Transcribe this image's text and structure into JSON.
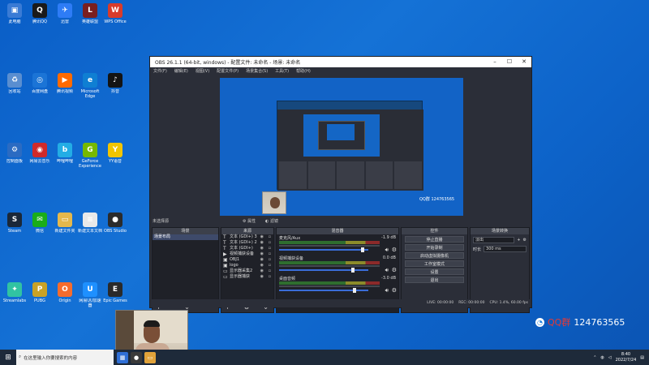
{
  "desktop": {
    "icons": [
      {
        "label": "此电脑",
        "color": "#3a7bd5",
        "glyph": "▣"
      },
      {
        "label": "腾讯QQ",
        "color": "#1a1a1a",
        "glyph": "Q"
      },
      {
        "label": "迅雷",
        "color": "#2e7cf6",
        "glyph": "✈"
      },
      {
        "label": "英雄联盟",
        "color": "#7a1f1f",
        "glyph": "L"
      },
      {
        "label": "WPS Office",
        "color": "#d83b2b",
        "glyph": "W"
      },
      {
        "label": "回收站",
        "color": "#5a8ed0",
        "glyph": "♻"
      },
      {
        "label": "百度网盘",
        "color": "#1b74d6",
        "glyph": "◎"
      },
      {
        "label": "腾讯视频",
        "color": "#ff6a00",
        "glyph": "▶"
      },
      {
        "label": "Microsoft Edge",
        "color": "#0f7fd3",
        "glyph": "e"
      },
      {
        "label": "抖音",
        "color": "#141414",
        "glyph": "♪"
      },
      {
        "label": "控制面板",
        "color": "#2b6bc2",
        "glyph": "⚙"
      },
      {
        "label": "网易云音乐",
        "color": "#d02a2a",
        "glyph": "◉"
      },
      {
        "label": "哔哩哔哩",
        "color": "#23ade5",
        "glyph": "b"
      },
      {
        "label": "GeForce Experience",
        "color": "#76b900",
        "glyph": "G"
      },
      {
        "label": "YY语音",
        "color": "#f2c500",
        "glyph": "Y"
      },
      {
        "label": "Steam",
        "color": "#1b2838",
        "glyph": "S"
      },
      {
        "label": "微信",
        "color": "#1aad19",
        "glyph": "✉"
      },
      {
        "label": "新建文件夹",
        "color": "#e6b84c",
        "glyph": "▭"
      },
      {
        "label": "新建文本文档",
        "color": "#e9e9e9",
        "glyph": "≡"
      },
      {
        "label": "OBS Studio",
        "color": "#2b2b2b",
        "glyph": "●"
      },
      {
        "label": "Streamlabs",
        "color": "#31c3a2",
        "glyph": "✦"
      },
      {
        "label": "PUBG",
        "color": "#c9a226",
        "glyph": "P"
      },
      {
        "label": "Origin",
        "color": "#f56c2d",
        "glyph": "O"
      },
      {
        "label": "网易UU加速器",
        "color": "#1e90ff",
        "glyph": "U"
      },
      {
        "label": "Epic Games",
        "color": "#2a2a2a",
        "glyph": "E"
      }
    ]
  },
  "obs": {
    "title": "OBS 26.1.1 (64-bit, windows) - 配置文件: 未命名 - 场景: 未命名",
    "menu": [
      "文件(F)",
      "编辑(E)",
      "视图(V)",
      "配置文件(P)",
      "场景集合(S)",
      "工具(T)",
      "帮助(H)"
    ],
    "no_source_selected": "未选择源",
    "properties_label": "属性",
    "filters_label": "滤镜",
    "preview_qq": "QQ群 124763565",
    "docks": {
      "scenes": {
        "title": "场景",
        "items": [
          "场景布局"
        ]
      },
      "sources": {
        "title": "来源",
        "items": [
          {
            "icon": "T",
            "label": "文本 (GDI+) 3"
          },
          {
            "icon": "T",
            "label": "文本 (GDI+) 2"
          },
          {
            "icon": "T",
            "label": "文本 (GDI+)"
          },
          {
            "icon": "▶",
            "label": "视频捕获设备"
          },
          {
            "icon": "▣",
            "label": "OBJ1"
          },
          {
            "icon": "▣",
            "label": "logo"
          },
          {
            "icon": "▭",
            "label": "显示器采集2"
          },
          {
            "icon": "▭",
            "label": "显示器捕获"
          }
        ]
      },
      "mixer": {
        "title": "混音器",
        "channels": [
          {
            "name": "麦克风/Aux",
            "db": "-1.9 dB"
          },
          {
            "name": "视频捕获设备",
            "db": "0.0 dB"
          },
          {
            "name": "桌面音频",
            "db": "-3.0 dB"
          }
        ]
      },
      "controls": {
        "title": "控件",
        "buttons": [
          "停止直播",
          "开始录制",
          "启动虚拟摄像机",
          "工作室模式",
          "设置",
          "退出"
        ]
      },
      "transitions": {
        "title": "场景转换",
        "type": "淡出",
        "duration_label": "时长",
        "duration_value": "300 ms"
      }
    },
    "status": {
      "live": "LIVE: 00:00:00",
      "rec": "REC: 00:00:00",
      "cpu": "CPU: 1.4%, 60.00 fps"
    }
  },
  "watermark": {
    "group_label": "QQ群",
    "group_number": "124763565"
  },
  "taskbar": {
    "search_placeholder": "在这里输入你要搜索的内容",
    "time": "8:40",
    "date": "2022/7/24"
  }
}
